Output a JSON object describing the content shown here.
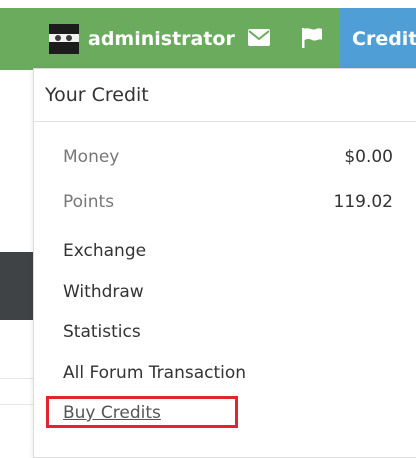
{
  "topbar": {
    "username": "administrator",
    "credit_label": "Credit",
    "icons": [
      "envelope-icon",
      "flag-icon"
    ],
    "colors": {
      "bar": "#6aab5e",
      "credit": "#4f9fd6"
    }
  },
  "dropdown": {
    "title": "Your Credit",
    "balances": [
      {
        "label": "Money",
        "value": "$0.00"
      },
      {
        "label": "Points",
        "value": "119.02"
      }
    ],
    "menu": [
      "Exchange",
      "Withdraw",
      "Statistics",
      "All Forum Transaction",
      "Buy Credits"
    ]
  },
  "highlight_color": "#e32330"
}
